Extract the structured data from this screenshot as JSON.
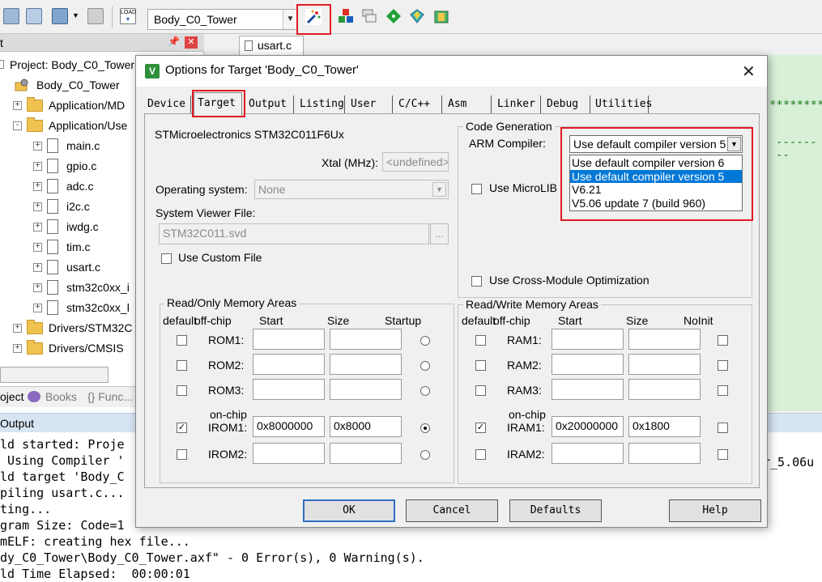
{
  "toolbar": {
    "target_name": "Body_C0_Tower",
    "load_label": "LOAD"
  },
  "project": {
    "panel_title": "t",
    "root": "Project: Body_C0_Tower",
    "target": "Body_C0_Tower",
    "items": [
      {
        "label": "Application/MD",
        "type": "folder",
        "expand": "+"
      },
      {
        "label": "Application/Use",
        "type": "folder-open",
        "expand": "-"
      },
      {
        "label": "main.c",
        "type": "file"
      },
      {
        "label": "gpio.c",
        "type": "file"
      },
      {
        "label": "adc.c",
        "type": "file"
      },
      {
        "label": "i2c.c",
        "type": "file"
      },
      {
        "label": "iwdg.c",
        "type": "file"
      },
      {
        "label": "tim.c",
        "type": "file"
      },
      {
        "label": "usart.c",
        "type": "file"
      },
      {
        "label": "stm32c0xx_i",
        "type": "file"
      },
      {
        "label": "stm32c0xx_l",
        "type": "file"
      },
      {
        "label": "Drivers/STM32C",
        "type": "folder",
        "expand": "+"
      },
      {
        "label": "Drivers/CMSIS",
        "type": "folder",
        "expand": "+"
      }
    ],
    "tabs": {
      "project": "oject",
      "books": "Books",
      "funcs": "{} Func..."
    }
  },
  "editor": {
    "tab": "usart.c",
    "stars": "********",
    "dashes": "--------"
  },
  "output": {
    "title": "Output",
    "lines": [
      "ld started: Proje",
      " Using Compiler '",
      "ld target 'Body_C",
      "piling usart.c...",
      "ting...",
      "gram Size: Code=1",
      "mELF: creating hex file...",
      "dy_C0_Tower\\Body_C0_Tower.axf\" - 0 Error(s), 0 Warning(s).",
      "ld Time Elapsed:  00:00:01"
    ],
    "right_fragment": "r_5.06u"
  },
  "dialog": {
    "title": "Options for Target 'Body_C0_Tower'",
    "tabs": [
      "Device",
      "Target",
      "Output",
      "Listing",
      "User",
      "C/C++",
      "Asm",
      "Linker",
      "Debug",
      "Utilities"
    ],
    "active_tab": "Target",
    "device": "STMicroelectronics STM32C011F6Ux",
    "xtal_label": "Xtal (MHz):",
    "xtal_value": "<undefined>",
    "os_label": "Operating system:",
    "os_value": "None",
    "svf_label": "System Viewer File:",
    "svf_value": "STM32C011.svd",
    "svf_browse": "...",
    "custom_file_label": "Use Custom File",
    "codegen": {
      "title": "Code Generation",
      "compiler_label": "ARM Compiler:",
      "compiler_value": "Use default compiler version 5",
      "options": [
        "Use default compiler version 6",
        "Use default compiler version 5",
        "V6.21",
        "V5.06 update 7 (build 960)"
      ],
      "selected_index": 1,
      "microlib_label": "Use MicroLIB",
      "cross_module_label": "Use Cross-Module Optimization"
    },
    "ro": {
      "title": "Read/Only Memory Areas",
      "headers": [
        "default",
        "off-chip",
        "Start",
        "Size",
        "Startup"
      ],
      "onchip_label": "on-chip",
      "rows": [
        {
          "name": "ROM1:",
          "start": "",
          "size": "",
          "default": false,
          "startup": false
        },
        {
          "name": "ROM2:",
          "start": "",
          "size": "",
          "default": false,
          "startup": false
        },
        {
          "name": "ROM3:",
          "start": "",
          "size": "",
          "default": false,
          "startup": false
        },
        {
          "name": "IROM1:",
          "start": "0x8000000",
          "size": "0x8000",
          "default": true,
          "startup": true
        },
        {
          "name": "IROM2:",
          "start": "",
          "size": "",
          "default": false,
          "startup": false
        }
      ]
    },
    "rw": {
      "title": "Read/Write Memory Areas",
      "headers": [
        "default",
        "off-chip",
        "Start",
        "Size",
        "NoInit"
      ],
      "onchip_label": "on-chip",
      "rows": [
        {
          "name": "RAM1:",
          "start": "",
          "size": "",
          "default": false,
          "noinit": false
        },
        {
          "name": "RAM2:",
          "start": "",
          "size": "",
          "default": false,
          "noinit": false
        },
        {
          "name": "RAM3:",
          "start": "",
          "size": "",
          "default": false,
          "noinit": false
        },
        {
          "name": "IRAM1:",
          "start": "0x20000000",
          "size": "0x1800",
          "default": true,
          "noinit": false
        },
        {
          "name": "IRAM2:",
          "start": "",
          "size": "",
          "default": false,
          "noinit": false
        }
      ]
    },
    "buttons": {
      "ok": "OK",
      "cancel": "Cancel",
      "defaults": "Defaults",
      "help": "Help"
    }
  },
  "colors": {
    "highlight_box": "#e01b24",
    "selection": "#0078d7"
  }
}
